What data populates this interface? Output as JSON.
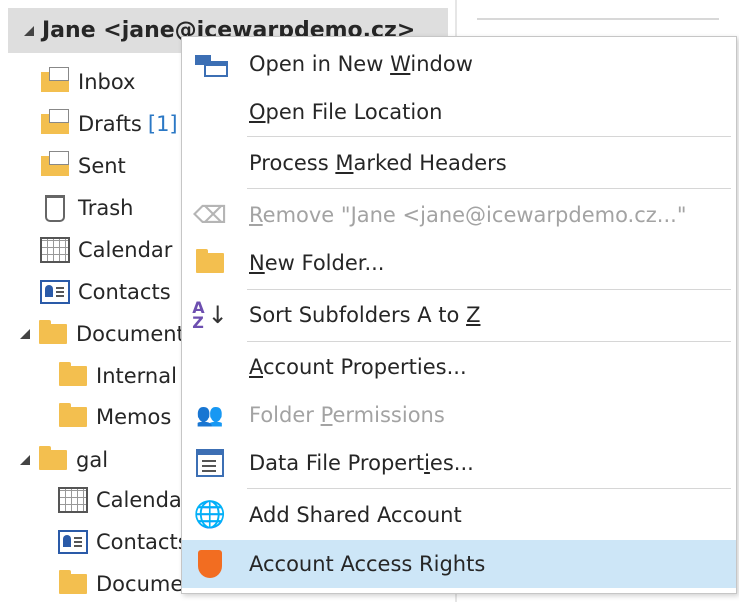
{
  "account": {
    "label": "Jane <jane@icewarpdemo.cz>"
  },
  "folders": [
    {
      "label": "Inbox",
      "icon": "inbox-icon"
    },
    {
      "label": "Drafts",
      "count": "[1]",
      "icon": "drafts-icon"
    },
    {
      "label": "Sent",
      "icon": "sent-icon"
    },
    {
      "label": "Trash",
      "icon": "trash-icon"
    },
    {
      "label": "Calendar",
      "icon": "calendar-icon"
    },
    {
      "label": "Contacts",
      "icon": "contacts-icon"
    },
    {
      "label": "Documents",
      "icon": "folder-icon"
    },
    {
      "label": "Internal",
      "icon": "folder-icon"
    },
    {
      "label": "Memos",
      "icon": "folder-icon"
    },
    {
      "label": "gal",
      "icon": "folder-icon"
    },
    {
      "label": "Calendar",
      "icon": "calendar-icon"
    },
    {
      "label": "Contacts",
      "icon": "contacts-icon"
    },
    {
      "label": "Documents",
      "icon": "folder-icon"
    }
  ],
  "context_menu": {
    "items": [
      {
        "pre": "Open in New ",
        "u": "W",
        "post": "indow",
        "icon": "new-window-icon",
        "enabled": true
      },
      {
        "pre": "",
        "u": "O",
        "post": "pen File Location",
        "icon": "",
        "enabled": true
      },
      {
        "pre": "Process ",
        "u": "M",
        "post": "arked Headers",
        "icon": "",
        "enabled": true
      },
      {
        "pre": "",
        "u": "R",
        "post": "emove \"Jane <jane@icewarpdemo.cz...\"",
        "icon": "remove-icon",
        "enabled": false
      },
      {
        "pre": "",
        "u": "N",
        "post": "ew Folder...",
        "icon": "folder-icon",
        "enabled": true
      },
      {
        "pre": "Sort Subfolders A to ",
        "u": "Z",
        "post": "",
        "icon": "sort-az-icon",
        "enabled": true
      },
      {
        "pre": "",
        "u": "A",
        "post": "ccount Properties...",
        "icon": "",
        "enabled": true
      },
      {
        "pre": "Folder ",
        "u": "P",
        "post": "ermissions",
        "icon": "permissions-icon",
        "enabled": false
      },
      {
        "pre": "Data File Propert",
        "u": "i",
        "post": "es...",
        "icon": "data-file-icon",
        "enabled": true
      },
      {
        "pre": "Add Shared Account",
        "u": "",
        "post": "",
        "icon": "globe-user-icon",
        "enabled": true
      },
      {
        "pre": "Account Access Rights",
        "u": "",
        "post": "",
        "icon": "shield-icon",
        "enabled": true,
        "highlighted": true
      }
    ]
  },
  "glyphs": {
    "remove": "⌫",
    "sort_a": "A",
    "sort_z": "Z",
    "arrow": "↓",
    "permissions": "👥",
    "globe": "🌐"
  },
  "colors": {
    "accent": "#2b78c5",
    "folder": "#f3bf4f",
    "hover": "#cde6f7",
    "shield": "#f26d21"
  }
}
